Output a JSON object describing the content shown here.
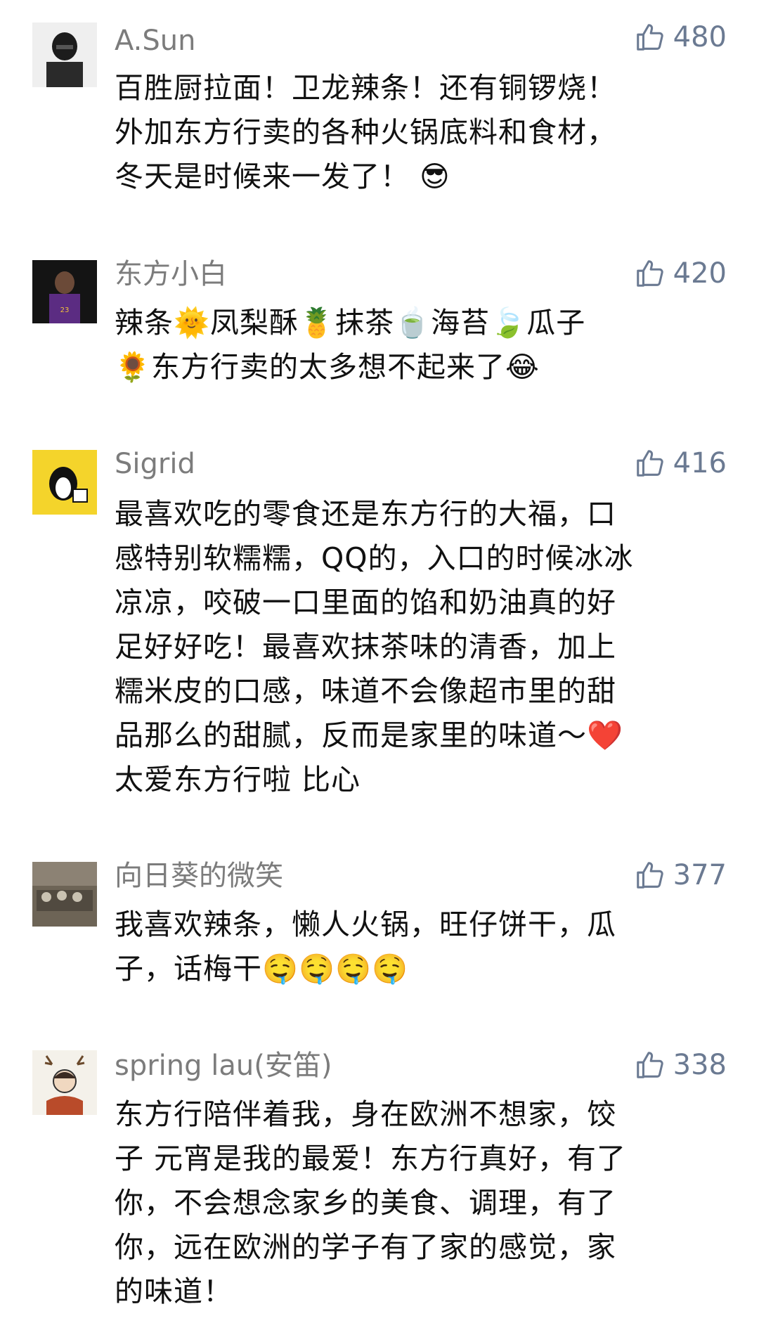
{
  "comments": [
    {
      "name": "A.Sun",
      "likes": "480",
      "text": "百胜厨拉面！卫龙辣条！还有铜锣烧！\n外加东方行卖的各种火锅底料和食材，\n冬天是时候来一发了！ 😎"
    },
    {
      "name": "东方小白",
      "likes": "420",
      "text": "辣条🌞凤梨酥🍍抹茶🍵海苔🍃瓜子\n🌻东方行卖的太多想不起来了😂"
    },
    {
      "name": "Sigrid",
      "likes": "416",
      "text": "最喜欢吃的零食还是东方行的大福，口\n感特别软糯糯，QQ的，入口的时候冰冰\n凉凉，咬破一口里面的馅和奶油真的好\n足好好吃！最喜欢抹茶味的清香，加上\n糯米皮的口感，味道不会像超市里的甜\n品那么的甜腻，反而是家里的味道～❤️\n太爱东方行啦 比心"
    },
    {
      "name": "向日葵的微笑",
      "likes": "377",
      "text": "我喜欢辣条，懒人火锅，旺仔饼干，瓜\n子，话梅干🤤🤤🤤🤤"
    },
    {
      "name": "spring lau(安笛)",
      "likes": "338",
      "text": "东方行陪伴着我，身在欧洲不想家，饺\n子 元宵是我的最爱！东方行真好，有了\n你，不会想念家乡的美食、调理，有了\n你，远在欧洲的学子有了家的感觉，家\n的味道！"
    }
  ],
  "icons": {
    "like": "thumbs-up-icon"
  },
  "colors": {
    "like": "#6b7a92",
    "name": "#7c7c7c"
  }
}
